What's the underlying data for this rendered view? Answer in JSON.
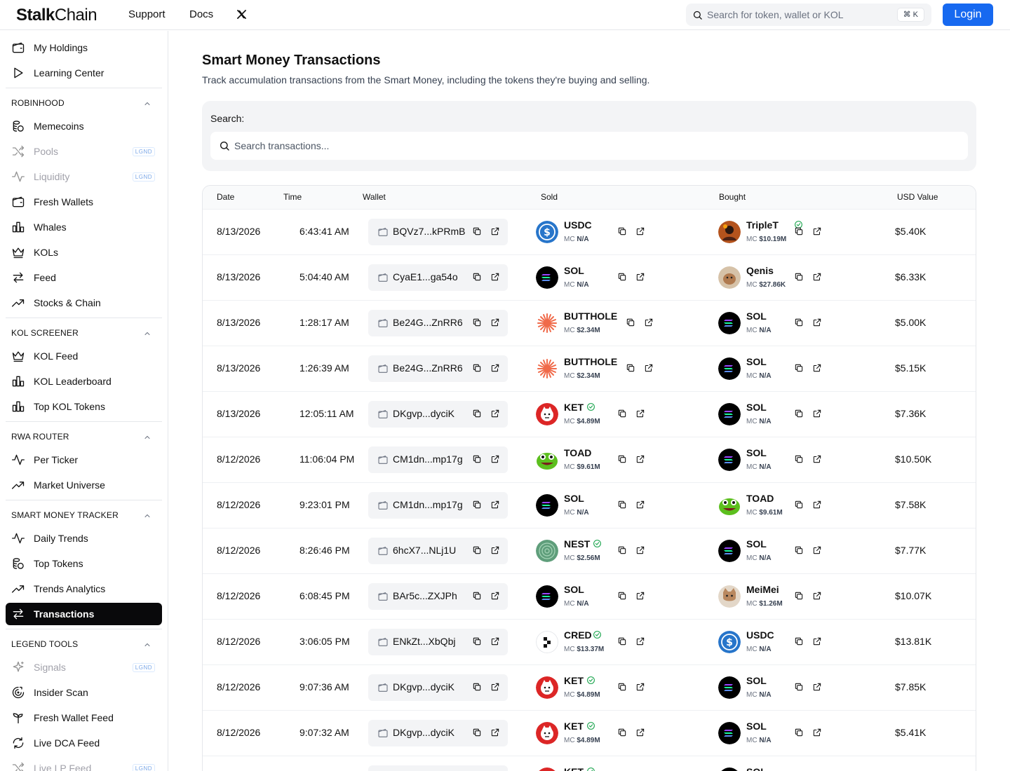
{
  "header": {
    "logo_bold": "Stalk",
    "logo_rest": "Chain",
    "nav": [
      "Support",
      "Docs"
    ],
    "search_placeholder": "Search for token, wallet or KOL",
    "search_shortcut": "⌘ K",
    "login_label": "Login"
  },
  "sidebar": {
    "top_items": [
      {
        "label": "My Holdings",
        "icon": "wallet-icon"
      },
      {
        "label": "Learning Center",
        "icon": "play-icon"
      }
    ],
    "sections": [
      {
        "title": "ROBINHOOD",
        "items": [
          {
            "label": "Memecoins",
            "icon": "coins-icon"
          },
          {
            "label": "Pools",
            "icon": "shuffle-icon",
            "badge": "LGND",
            "disabled": true
          },
          {
            "label": "Liquidity",
            "icon": "activity-icon",
            "badge": "LGND",
            "disabled": true
          },
          {
            "label": "Fresh Wallets",
            "icon": "wallet-icon"
          },
          {
            "label": "Whales",
            "icon": "bar-chart-icon"
          },
          {
            "label": "KOLs",
            "icon": "crown-icon"
          },
          {
            "label": "Feed",
            "icon": "arrows-exchange-icon"
          },
          {
            "label": "Stocks & Chain",
            "icon": "trending-up-icon"
          }
        ]
      },
      {
        "title": "KOL SCREENER",
        "items": [
          {
            "label": "KOL Feed",
            "icon": "crown-icon"
          },
          {
            "label": "KOL Leaderboard",
            "icon": "bar-chart-icon"
          },
          {
            "label": "Top KOL Tokens",
            "icon": "bar-chart-icon"
          }
        ]
      },
      {
        "title": "RWA ROUTER",
        "items": [
          {
            "label": "Per Ticker",
            "icon": "activity-icon"
          },
          {
            "label": "Market Universe",
            "icon": "trending-up-icon"
          }
        ]
      },
      {
        "title": "SMART MONEY TRACKER",
        "items": [
          {
            "label": "Daily Trends",
            "icon": "activity-icon"
          },
          {
            "label": "Top Tokens",
            "icon": "coins-icon"
          },
          {
            "label": "Trends Analytics",
            "icon": "trending-up-icon"
          },
          {
            "label": "Transactions",
            "icon": "arrows-exchange-icon",
            "active": true
          }
        ]
      },
      {
        "title": "LEGEND TOOLS",
        "items": [
          {
            "label": "Signals",
            "icon": "sparkles-icon",
            "badge": "LGND",
            "disabled": true
          },
          {
            "label": "Insider Scan",
            "icon": "scan-icon"
          },
          {
            "label": "Fresh Wallet Feed",
            "icon": "sprout-icon"
          },
          {
            "label": "Live DCA Feed",
            "icon": "refresh-icon"
          },
          {
            "label": "Live LP Feed",
            "icon": "shuffle-icon",
            "badge": "LGND",
            "disabled": true
          }
        ]
      }
    ]
  },
  "main": {
    "title": "Smart Money Transactions",
    "subtitle": "Track accumulation transactions from the Smart Money, including the tokens they're buying and selling.",
    "search_label": "Search:",
    "search_placeholder": "Search transactions..."
  },
  "table": {
    "columns": [
      "Date",
      "Time",
      "Wallet",
      "Sold",
      "Bought",
      "USD Value"
    ],
    "rows": [
      {
        "date": "8/13/2026",
        "time": "6:43:41 AM",
        "wallet": "BQVz7...kPRmB",
        "sold": {
          "symbol": "USDC",
          "mc": "N/A",
          "logo": "usdc",
          "verified": false
        },
        "bought": {
          "symbol": "TripleT",
          "mc": "$10.19M",
          "logo": "triplet",
          "verified": true
        },
        "usd": "$5.40K"
      },
      {
        "date": "8/13/2026",
        "time": "5:04:40 AM",
        "wallet": "CyaE1...ga54o",
        "sold": {
          "symbol": "SOL",
          "mc": "N/A",
          "logo": "sol",
          "verified": false
        },
        "bought": {
          "symbol": "Qenis",
          "mc": "$27.86K",
          "logo": "qenis",
          "verified": false
        },
        "usd": "$6.33K"
      },
      {
        "date": "8/13/2026",
        "time": "1:28:17 AM",
        "wallet": "Be24G...ZnRR6",
        "sold": {
          "symbol": "BUTTHOLE",
          "mc": "$2.34M",
          "logo": "butthole",
          "verified": false
        },
        "bought": {
          "symbol": "SOL",
          "mc": "N/A",
          "logo": "sol",
          "verified": false
        },
        "usd": "$5.00K"
      },
      {
        "date": "8/13/2026",
        "time": "1:26:39 AM",
        "wallet": "Be24G...ZnRR6",
        "sold": {
          "symbol": "BUTTHOLE",
          "mc": "$2.34M",
          "logo": "butthole",
          "verified": false
        },
        "bought": {
          "symbol": "SOL",
          "mc": "N/A",
          "logo": "sol",
          "verified": false
        },
        "usd": "$5.15K"
      },
      {
        "date": "8/13/2026",
        "time": "12:05:11 AM",
        "wallet": "DKgvp...dyciK",
        "sold": {
          "symbol": "KET",
          "mc": "$4.89M",
          "logo": "ket",
          "verified": true
        },
        "bought": {
          "symbol": "SOL",
          "mc": "N/A",
          "logo": "sol",
          "verified": false
        },
        "usd": "$7.36K"
      },
      {
        "date": "8/12/2026",
        "time": "11:06:04 PM",
        "wallet": "CM1dn...mp17g",
        "sold": {
          "symbol": "TOAD",
          "mc": "$9.61M",
          "logo": "toad",
          "verified": false
        },
        "bought": {
          "symbol": "SOL",
          "mc": "N/A",
          "logo": "sol",
          "verified": false
        },
        "usd": "$10.50K"
      },
      {
        "date": "8/12/2026",
        "time": "9:23:01 PM",
        "wallet": "CM1dn...mp17g",
        "sold": {
          "symbol": "SOL",
          "mc": "N/A",
          "logo": "sol",
          "verified": false
        },
        "bought": {
          "symbol": "TOAD",
          "mc": "$9.61M",
          "logo": "toad",
          "verified": false
        },
        "usd": "$7.58K"
      },
      {
        "date": "8/12/2026",
        "time": "8:26:46 PM",
        "wallet": "6hcX7...NLj1U",
        "sold": {
          "symbol": "NEST",
          "mc": "$2.56M",
          "logo": "nest",
          "verified": true
        },
        "bought": {
          "symbol": "SOL",
          "mc": "N/A",
          "logo": "sol",
          "verified": false
        },
        "usd": "$7.77K"
      },
      {
        "date": "8/12/2026",
        "time": "6:08:45 PM",
        "wallet": "BAr5c...ZXJPh",
        "sold": {
          "symbol": "SOL",
          "mc": "N/A",
          "logo": "sol",
          "verified": false
        },
        "bought": {
          "symbol": "MeiMei",
          "mc": "$1.26M",
          "logo": "meimei",
          "verified": false
        },
        "usd": "$10.07K"
      },
      {
        "date": "8/12/2026",
        "time": "3:06:05 PM",
        "wallet": "ENkZt...XbQbj",
        "sold": {
          "symbol": "CRED",
          "mc": "$13.37M",
          "logo": "cred",
          "verified": true
        },
        "bought": {
          "symbol": "USDC",
          "mc": "N/A",
          "logo": "usdc",
          "verified": false
        },
        "usd": "$13.81K"
      },
      {
        "date": "8/12/2026",
        "time": "9:07:36 AM",
        "wallet": "DKgvp...dyciK",
        "sold": {
          "symbol": "KET",
          "mc": "$4.89M",
          "logo": "ket",
          "verified": true
        },
        "bought": {
          "symbol": "SOL",
          "mc": "N/A",
          "logo": "sol",
          "verified": false
        },
        "usd": "$7.85K"
      },
      {
        "date": "8/12/2026",
        "time": "9:07:32 AM",
        "wallet": "DKgvp...dyciK",
        "sold": {
          "symbol": "KET",
          "mc": "$4.89M",
          "logo": "ket",
          "verified": true
        },
        "bought": {
          "symbol": "SOL",
          "mc": "N/A",
          "logo": "sol",
          "verified": false
        },
        "usd": "$5.41K"
      },
      {
        "date": "",
        "time": "",
        "wallet": "",
        "sold": {
          "symbol": "KET",
          "mc": "",
          "logo": "ket",
          "verified": true
        },
        "bought": {
          "symbol": "SOL",
          "mc": "",
          "logo": "sol",
          "verified": false
        },
        "usd": ""
      }
    ]
  },
  "colors": {
    "accent": "#1769f0",
    "active_bg": "#09090b",
    "verified": "#16a34a",
    "usdc": "#2775ca"
  }
}
